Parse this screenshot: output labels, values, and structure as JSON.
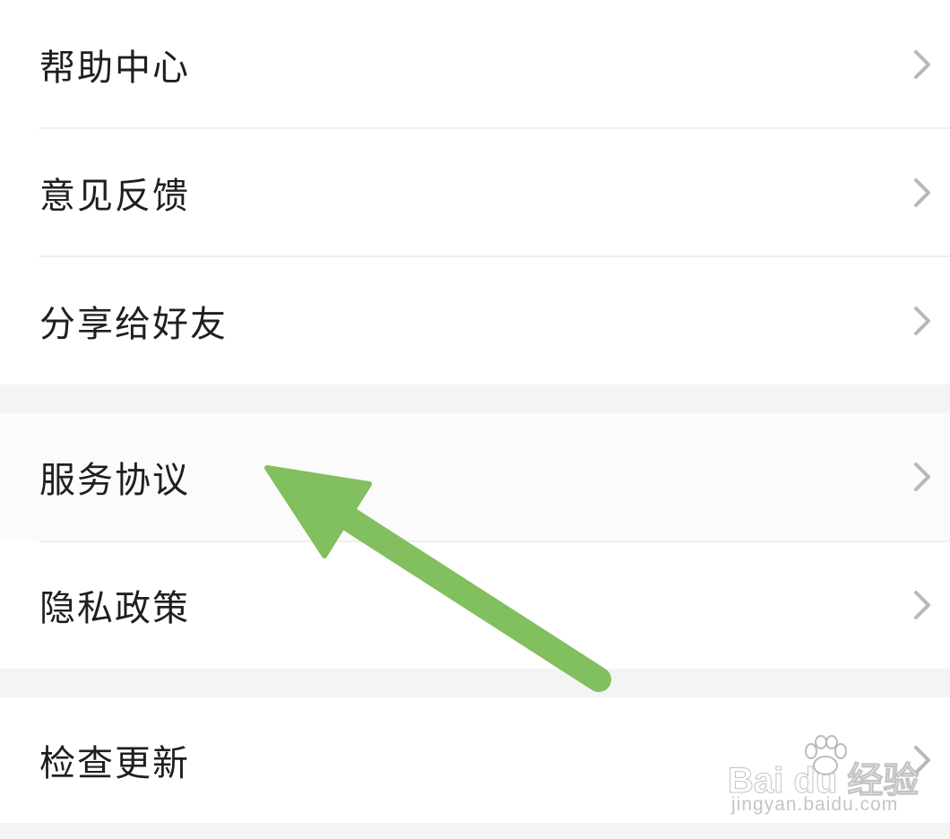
{
  "settings_menu": {
    "group_1": [
      {
        "label": "帮助中心"
      },
      {
        "label": "意见反馈"
      },
      {
        "label": "分享给好友"
      }
    ],
    "group_2": [
      {
        "label": "服务协议"
      },
      {
        "label": "隐私政策"
      }
    ],
    "group_3": [
      {
        "label": "检查更新"
      }
    ]
  },
  "icons": {
    "row_chevron": "chevron-right-icon",
    "annotation": "arrow-icon"
  },
  "watermark": {
    "brand": "Bai du 经验",
    "url": "jingyan.baidu.com"
  },
  "colors": {
    "page_background": "#f4f4f4",
    "row_background": "#ffffff",
    "text": "#1f1f1f",
    "chevron": "#b8b8b8",
    "divider": "#efefef",
    "annotation_arrow": "#82bf5e"
  }
}
